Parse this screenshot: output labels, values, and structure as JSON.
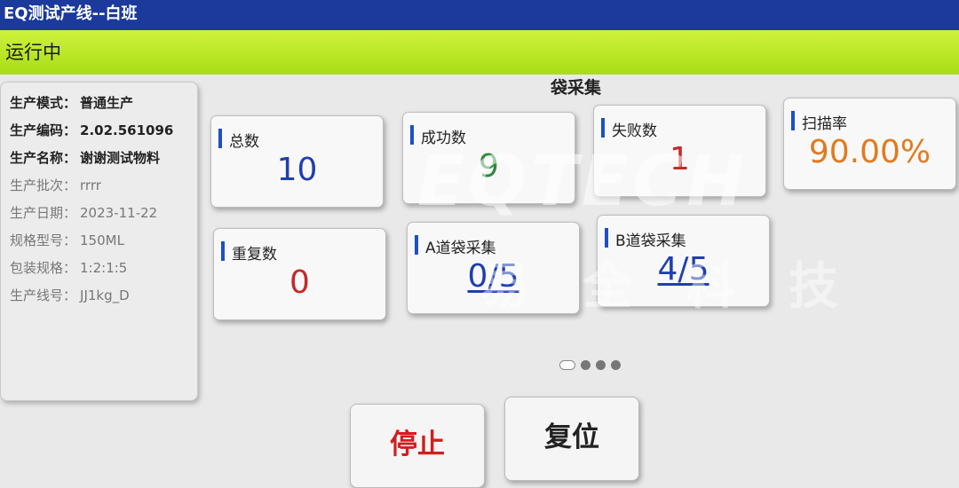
{
  "window": {
    "title": "EQ测试产线--白班"
  },
  "status": {
    "text": "运行中"
  },
  "info": {
    "rows": [
      {
        "key": "生产模式：",
        "value": "普通生产",
        "style": "dark"
      },
      {
        "key": "生产编码：",
        "value": "2.02.561096",
        "style": "dark"
      },
      {
        "key": "生产名称：",
        "value": "谢谢测试物料",
        "style": "dark"
      },
      {
        "key": "生产批次：",
        "value": "rrrr",
        "style": "light"
      },
      {
        "key": "生产日期：",
        "value": "2023-11-22",
        "style": "light"
      },
      {
        "key": "规格型号：",
        "value": "150ML",
        "style": "light"
      },
      {
        "key": "包装规格：",
        "value": "1:2:1:5",
        "style": "light"
      },
      {
        "key": "生产线号：",
        "value": "JJ1kg_D",
        "style": "light"
      }
    ]
  },
  "section": {
    "title": "袋采集"
  },
  "cards": {
    "total": {
      "label": "总数",
      "value": "10",
      "color": "#1f3fb0"
    },
    "success": {
      "label": "成功数",
      "value": "9",
      "color": "#2e8b3a"
    },
    "fail": {
      "label": "失败数",
      "value": "1",
      "color": "#c62828"
    },
    "scan_rate": {
      "label": "扫描率",
      "value": "90.00%",
      "color": "#e07b1f"
    },
    "repeat": {
      "label": "重复数",
      "value": "0",
      "color": "#c62828"
    },
    "lane_a": {
      "label": "A道袋采集",
      "value": "0/5",
      "color": "#1f3fb0"
    },
    "lane_b": {
      "label": "B道袋采集",
      "value": "4/5",
      "color": "#1f3fb0"
    }
  },
  "pager": {
    "count": 4,
    "active": 0
  },
  "buttons": {
    "stop": {
      "label": "停止",
      "color": "#d01f1f"
    },
    "reset": {
      "label": "复位",
      "color": "#222222"
    }
  },
  "watermark": {
    "text": "EQTECH",
    "subtext": "易全科技"
  }
}
